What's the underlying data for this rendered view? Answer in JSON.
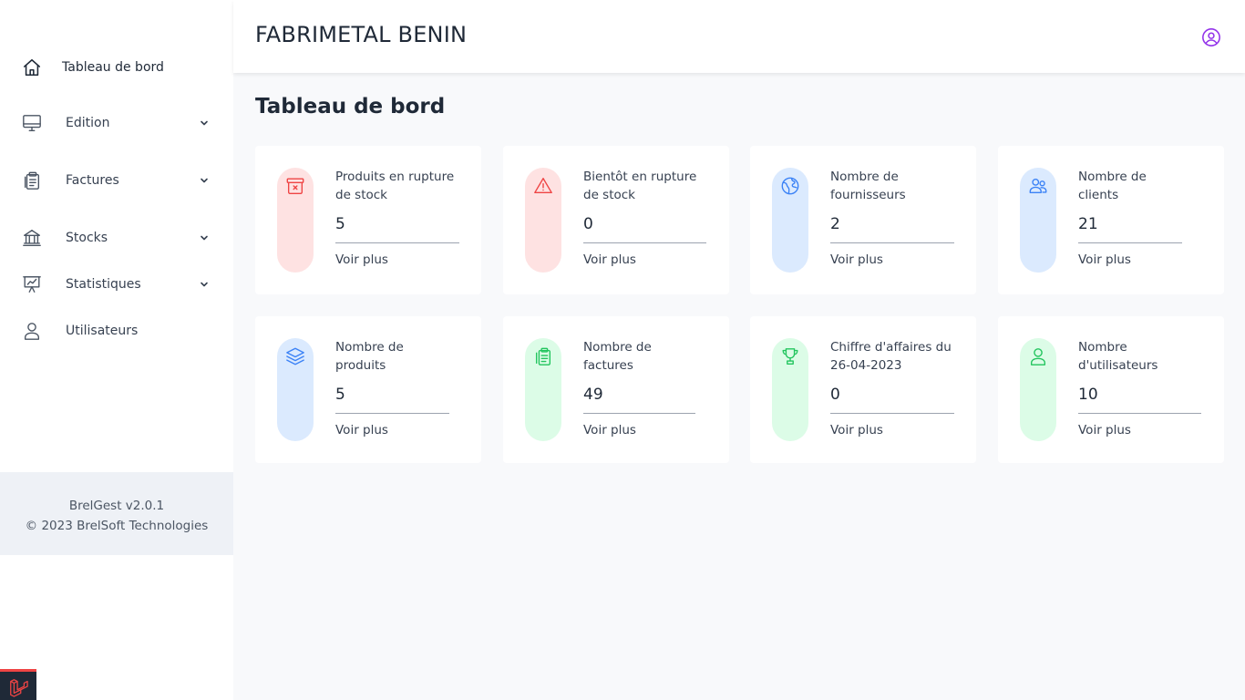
{
  "sidebar": {
    "items": [
      {
        "label": "Tableau de bord",
        "icon": "home-icon",
        "active": true
      },
      {
        "label": "Edition",
        "icon": "monitor-icon"
      },
      {
        "label": "Factures",
        "icon": "clipboard-icon"
      },
      {
        "label": "Stocks",
        "icon": "bank-icon"
      },
      {
        "label": "Statistiques",
        "icon": "presentation-chart-icon"
      },
      {
        "label": "Utilisateurs",
        "icon": "user-icon"
      }
    ],
    "footer": {
      "version": "BrelGest v2.0.1",
      "copyright": "© 2023 BrelSoft Technologies"
    }
  },
  "header": {
    "company": "FABRIMETAL BENIN",
    "user_icon": "user-circle-icon",
    "accent_color": "#9333ea"
  },
  "page": {
    "title": "Tableau de bord"
  },
  "cards": [
    {
      "label": "Produits en rupture de stock",
      "value": "5",
      "link": "Voir plus",
      "icon": "archive-x-icon",
      "color": "#ef4444"
    },
    {
      "label": "Bientôt en rupture de stock",
      "value": "0",
      "link": "Voir plus",
      "icon": "warning-icon",
      "color": "#ef4444"
    },
    {
      "label": "Nombre de fournisseurs",
      "value": "2",
      "link": "Voir plus",
      "icon": "globe-icon",
      "color": "#3b82f6"
    },
    {
      "label": "Nombre de clients",
      "value": "21",
      "link": "Voir plus",
      "icon": "users-icon",
      "color": "#3b82f6"
    },
    {
      "label": "Nombre de produits",
      "value": "5",
      "link": "Voir plus",
      "icon": "layers-icon",
      "color": "#3b82f6"
    },
    {
      "label": "Nombre de factures",
      "value": "49",
      "link": "Voir plus",
      "icon": "documents-icon",
      "color": "#22c55e"
    },
    {
      "label": "Chiffre d'affaires du 26-04-2023",
      "value": "0",
      "link": "Voir plus",
      "icon": "trophy-icon",
      "color": "#22c55e"
    },
    {
      "label": "Nombre d'utilisateurs",
      "value": "10",
      "link": "Voir plus",
      "icon": "user-icon",
      "color": "#22c55e"
    }
  ]
}
